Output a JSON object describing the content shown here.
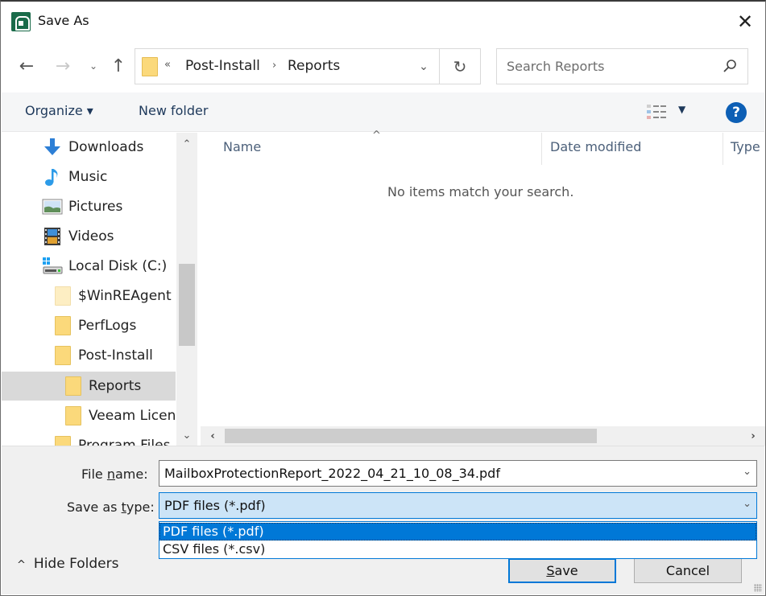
{
  "window": {
    "title": "Save As",
    "close_glyph": "✕"
  },
  "nav": {
    "back_glyph": "←",
    "forward_glyph": "→",
    "recent_glyph": "⌄",
    "up_glyph": "↑"
  },
  "address": {
    "overflow_glyph": "«",
    "crumbs": [
      "Post-Install",
      "Reports"
    ],
    "separator_glyph": "›",
    "dropdown_glyph": "⌄",
    "refresh_glyph": "↻"
  },
  "search": {
    "placeholder": "Search Reports",
    "value": ""
  },
  "toolbar": {
    "organize_label": "Organize ▾",
    "new_folder_label": "New folder",
    "view_dropdown_glyph": "▼",
    "help_glyph": "?"
  },
  "sidebar": {
    "scroll_up_glyph": "⌃",
    "scroll_down_glyph": "⌄",
    "items": [
      {
        "label": "Downloads",
        "icon": "downloads-icon",
        "level": 0,
        "selected": false
      },
      {
        "label": "Music",
        "icon": "music-icon",
        "level": 0,
        "selected": false
      },
      {
        "label": "Pictures",
        "icon": "pictures-icon",
        "level": 0,
        "selected": false
      },
      {
        "label": "Videos",
        "icon": "videos-icon",
        "level": 0,
        "selected": false
      },
      {
        "label": "Local Disk (C:)",
        "icon": "local-disk-icon",
        "level": 0,
        "selected": false
      },
      {
        "label": "$WinREAgent",
        "icon": "hidden-folder-icon",
        "level": 1,
        "selected": false
      },
      {
        "label": "PerfLogs",
        "icon": "folder-icon",
        "level": 1,
        "selected": false
      },
      {
        "label": "Post-Install",
        "icon": "folder-icon",
        "level": 1,
        "selected": false
      },
      {
        "label": "Reports",
        "icon": "folder-icon",
        "level": 2,
        "selected": true
      },
      {
        "label": "Veeam Licens",
        "icon": "folder-icon",
        "level": 2,
        "selected": false
      },
      {
        "label": "Program Files",
        "icon": "folder-icon",
        "level": 1,
        "selected": false
      }
    ]
  },
  "filelist": {
    "columns": [
      "Name",
      "Date modified",
      "Type"
    ],
    "sort_glyph": "^",
    "empty_message": "No items match your search.",
    "scroll_left_glyph": "‹",
    "scroll_right_glyph": "›"
  },
  "form": {
    "file_name_label_pre": "File ",
    "file_name_label_u": "n",
    "file_name_label_post": "ame:",
    "file_name_value": "MailboxProtectionReport_2022_04_21_10_08_34.pdf",
    "save_type_label_pre": "Save as ",
    "save_type_label_u": "t",
    "save_type_label_post": "ype:",
    "save_type_value": "PDF files (*.pdf)",
    "chevron_glyph": "⌄",
    "save_type_options": [
      "PDF files (*.pdf)",
      "CSV files (*.csv)"
    ],
    "active_option": 0
  },
  "footer": {
    "hide_folders_caret": "^",
    "hide_folders_label": "Hide Folders",
    "save_label_u": "S",
    "save_label_post": "ave",
    "cancel_label": "Cancel"
  },
  "colors": {
    "accent": "#0078d7",
    "app_icon": "#1a6b4a",
    "help_icon": "#0d5fb5",
    "folder": "#fbd97b",
    "toolbar_text": "#1e395b",
    "selection_bg": "#cce4f7"
  }
}
